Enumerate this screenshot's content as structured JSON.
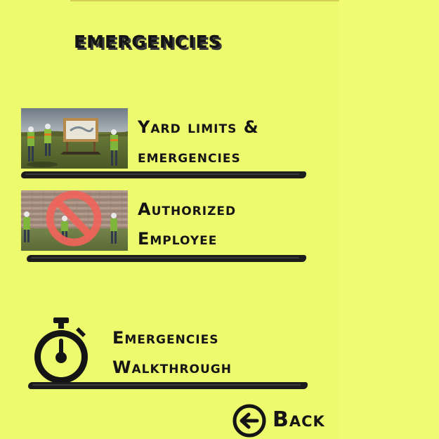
{
  "app": {
    "background_color": "#eefa6e",
    "ink_color": "#141414"
  },
  "header": {
    "title": "Emergencies"
  },
  "menu": {
    "items": [
      {
        "id": "yard-limits",
        "label_line1": "Yard limits &",
        "label_line2": "emergencies",
        "thumbnail": "workers-with-signboard-thumbnail"
      },
      {
        "id": "authorized-employee",
        "label_line1": "Authorized",
        "label_line2": "Employee",
        "thumbnail": "prohibited-sign-workers-thumbnail"
      }
    ]
  },
  "walkthrough": {
    "label_line1": "Emergencies",
    "label_line2": "Walkthrough",
    "icon": "stopwatch-icon"
  },
  "footer": {
    "back_label": "Back",
    "back_icon": "arrow-left-circle-icon"
  }
}
